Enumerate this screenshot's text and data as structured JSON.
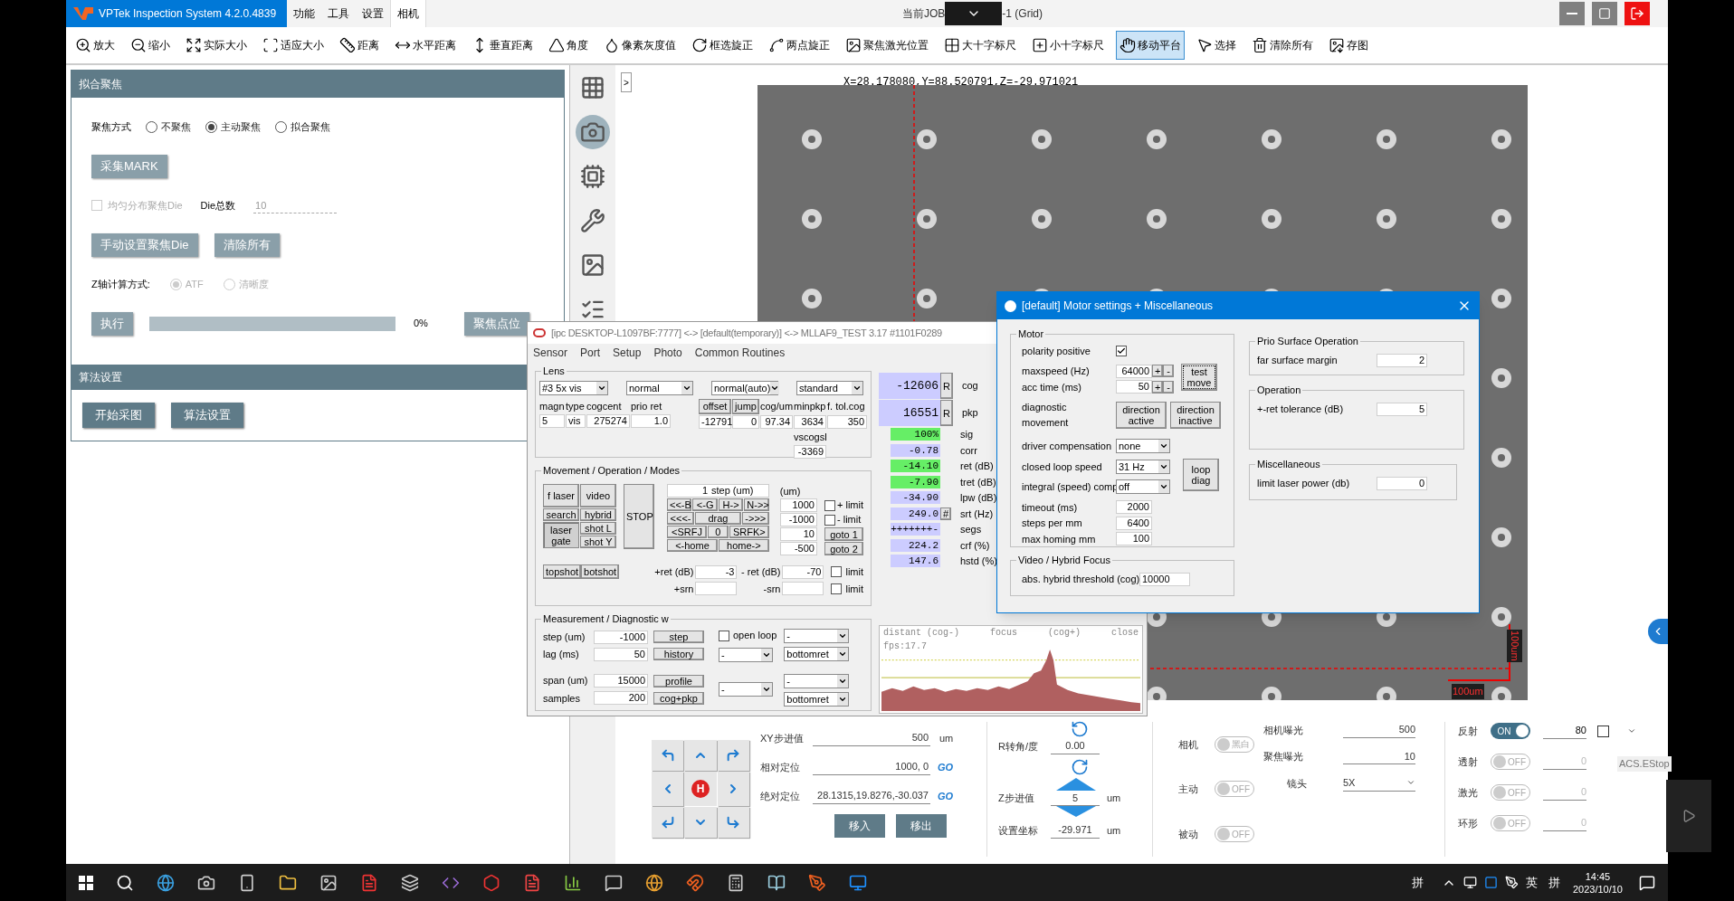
{
  "app_title": "VPTek Inspection System 4.2.0.4839",
  "menu": [
    {
      "label": "功能",
      "selected": false
    },
    {
      "label": "工具",
      "selected": false
    },
    {
      "label": "设置",
      "selected": false
    },
    {
      "label": "相机",
      "selected": true
    }
  ],
  "job": {
    "label": "当前JOB",
    "suffix": "-1 (Grid)"
  },
  "toolbar": [
    {
      "label": "放大",
      "selected": false
    },
    {
      "label": "缩小",
      "selected": false
    },
    {
      "label": "实际大小",
      "selected": false
    },
    {
      "label": "适应大小",
      "selected": false
    },
    {
      "label": "距离",
      "selected": false
    },
    {
      "label": "水平距离",
      "selected": false
    },
    {
      "label": "垂直距离",
      "selected": false
    },
    {
      "label": "角度",
      "selected": false
    },
    {
      "label": "像素灰度值",
      "selected": false
    },
    {
      "label": "框选旋正",
      "selected": false
    },
    {
      "label": "两点旋正",
      "selected": false
    },
    {
      "label": "聚焦激光位置",
      "selected": false
    },
    {
      "label": "大十字标尺",
      "selected": false
    },
    {
      "label": "小十字标尺",
      "selected": false
    },
    {
      "label": "移动平台",
      "selected": true
    },
    {
      "label": "选择",
      "selected": false
    },
    {
      "label": "清除所有",
      "selected": false
    },
    {
      "label": "存图",
      "selected": false
    }
  ],
  "focus_panel": {
    "title": "拟合聚焦",
    "mode_label": "聚焦方式",
    "modes": [
      {
        "label": "不聚焦",
        "selected": false
      },
      {
        "label": "主动聚焦",
        "selected": true
      },
      {
        "label": "拟合聚焦",
        "selected": false
      }
    ],
    "mark_button": {
      "label": "采集MARK",
      "disabled": true
    },
    "uniform": {
      "label": "均匀分布聚焦Die",
      "checked": false,
      "disabled": true
    },
    "die_count": {
      "label": "Die总数",
      "value": "10"
    },
    "die_buttons": [
      {
        "label": "手动设置聚焦Die",
        "disabled": true
      },
      {
        "label": "清除所有",
        "disabled": true
      }
    ],
    "z_label": "Z轴计算方式:",
    "z_modes": [
      {
        "label": "ATF",
        "selected": true,
        "disabled": true
      },
      {
        "label": "清晰度",
        "selected": false,
        "disabled": true
      }
    ],
    "run_button": {
      "label": "执行",
      "disabled": true
    },
    "progress": {
      "level": 0,
      "reading": "0%"
    },
    "points_button": {
      "label": "聚焦点位",
      "disabled": true
    }
  },
  "algo_panel": {
    "title": "算法设置",
    "buttons": [
      "开始采图",
      "算法设置"
    ]
  },
  "side_icons": [
    {
      "selected": false
    },
    {
      "selected": true
    },
    {
      "selected": false
    },
    {
      "selected": false
    },
    {
      "selected": false
    },
    {
      "selected": false
    }
  ],
  "collapse_button": ">",
  "viewer": {
    "coords": "X=28.178080,Y=88.520791,Z=-29.971021",
    "scale_x": "100um",
    "scale_y": "100um"
  },
  "msg_window": {
    "title": "[ipc DESKTOP-L1097BF:7777] <-> [default(temporary)] <-> MLLAF9_TEST 3.17 #1101F0289",
    "menus": [
      "Sensor",
      "Port",
      "Setup",
      "Photo",
      "Common Routines"
    ],
    "lens": {
      "title": "Lens",
      "selects": [
        "#3 5x vis",
        "normal",
        "normal(auto)",
        "standard"
      ],
      "headers": [
        "magn",
        "type",
        "cogcent",
        "prio ret"
      ],
      "values": [
        "5",
        "vis",
        "275274",
        "1.0"
      ],
      "buttons": [
        "offset",
        "jump"
      ],
      "headers2": [
        "cog/um",
        "minpkp",
        "f. tol.cog"
      ],
      "values2": [
        "-12791",
        "0",
        "97.34",
        "3634",
        "350"
      ],
      "vscogsl_label": "vscogsl",
      "vscogsl": "-3369"
    },
    "readouts": [
      {
        "value": "-12606",
        "button": "R",
        "label": "cog",
        "color": "#ccccff",
        "big": true
      },
      {
        "value": "16551",
        "button": "R",
        "label": "pkp",
        "color": "#ccccff",
        "big": true
      },
      {
        "value": "100%",
        "label": "sig",
        "color": "#66ee66",
        "big": false
      },
      {
        "value": "-0.78",
        "label": "corr",
        "color": "#ccccff",
        "big": false
      },
      {
        "value": "-14.10",
        "label": "ret (dB)",
        "color": "#66ee66",
        "big": false
      },
      {
        "value": "-7.90",
        "label": "tret (dB)",
        "color": "#66ee66",
        "big": false
      },
      {
        "value": "-34.90",
        "label": "lpw (dB)",
        "color": "#ccccff",
        "big": false
      },
      {
        "value": "249.0",
        "button": "#",
        "label": "srt (Hz)",
        "color": "#ccccff",
        "big": false
      },
      {
        "value": "+++++++-",
        "label": "segs",
        "color": "#ccccff",
        "big": false
      },
      {
        "value": "224.2",
        "label": "crf (%)",
        "color": "#ccccff",
        "big": false
      },
      {
        "value": "147.6",
        "label": "hstd (%)",
        "color": "#ccccff",
        "big": false
      }
    ],
    "movement": {
      "title": "Movement / Operation / Modes",
      "modes": [
        {
          "label": "f laser",
          "selected": false
        },
        {
          "label": "video",
          "selected": false
        },
        {
          "label": "search",
          "selected": false
        },
        {
          "label": "hybrid",
          "selected": false
        },
        {
          "label": "laser gate",
          "selected": true
        },
        {
          "label": "shot L",
          "selected": false
        },
        {
          "label": "shot Y",
          "selected": false
        }
      ],
      "stop": "STOP",
      "step_value": "1",
      "step_label": "step (um)",
      "jog": [
        "<<-B",
        "<-G",
        "H->",
        "N->>",
        "<<<-",
        "drag",
        "->>>",
        "<SRFJ",
        "0",
        "SRFK>",
        "<-home",
        "home->"
      ],
      "um_label": "(um)",
      "positions": [
        "1000",
        "-1000",
        "10",
        "-500"
      ],
      "limits": [
        {
          "label": "+ limit",
          "checked": false
        },
        {
          "label": "- limit",
          "checked": false
        }
      ],
      "goto": [
        "goto 1",
        "goto 2"
      ],
      "shots": [
        "topshot",
        "botshot"
      ],
      "ret_rows": [
        {
          "label": "+ret (dB)",
          "value": "-3",
          "label2": "- ret (dB)",
          "value2": "-70",
          "limit": "limit",
          "checked": false
        },
        {
          "label": "+srn",
          "label2": "-srn",
          "limit": "limit",
          "checked": false
        }
      ]
    },
    "measurement": {
      "title": "Measurement / Diagnostic w",
      "rows": [
        {
          "label": "step (um)",
          "value": "-1000",
          "button": "step"
        },
        {
          "label": "lag (ms)",
          "value": "50",
          "button": "history"
        },
        {
          "label": "span (um)",
          "value": "15000",
          "button": "profile"
        },
        {
          "label": "samples",
          "value": "200",
          "button": "cog+pkp"
        }
      ],
      "open_loop": {
        "label": "open loop",
        "checked": false
      },
      "selects": [
        "-",
        "-",
        "bottomret",
        "-",
        "-",
        "bottomret"
      ]
    },
    "chart": {
      "labels": [
        "distant (cog-)",
        "focus",
        "(cog+)",
        "close"
      ],
      "fps": "fps:17.7"
    }
  },
  "motor_window": {
    "title": "[default] Motor settings + Miscellaneous",
    "motor": {
      "title": "Motor",
      "polarity": {
        "label": "polarity positive",
        "checked": true
      },
      "speeds": [
        {
          "label": "maxspeed (Hz)",
          "value": "64000"
        },
        {
          "label": "acc time (ms)",
          "value": "50"
        }
      ],
      "plus": "+",
      "minus": "-",
      "test_button": "test move",
      "diag_label": "diagnostic movement",
      "diag_buttons": [
        "direction active",
        "direction inactive"
      ],
      "selects": [
        {
          "label": "driver compensation",
          "value": "none"
        },
        {
          "label": "closed loop speed",
          "value": "31 Hz"
        },
        {
          "label": "integral (speed) comp",
          "value": "off"
        }
      ],
      "loop_button": "loop diag",
      "fields": [
        {
          "label": "timeout (ms)",
          "value": "2000"
        },
        {
          "label": "steps per mm",
          "value": "6400"
        },
        {
          "label": "max homing mm",
          "value": "100"
        }
      ]
    },
    "video": {
      "title": "Video / Hybrid Focus",
      "label": "abs. hybrid threshold (cog)",
      "value": "10000"
    },
    "groups": [
      {
        "title": "Prio Surface Operation",
        "label": "far surface margin",
        "value": "2"
      },
      {
        "title": "Operation",
        "label": "+-ret tolerance (dB)",
        "value": "5"
      },
      {
        "title": "Miscellaneous",
        "label": "limit laser power (db)",
        "value": "0"
      }
    ]
  },
  "stage": {
    "home": "H",
    "rows": [
      {
        "label": "XY步进值",
        "value": "500",
        "unit": "um"
      },
      {
        "label": "相对定位",
        "value": "1000, 0",
        "go": "GO"
      },
      {
        "label": "绝对定位",
        "value": "28.1315,19.8276,-30.037",
        "go": "GO"
      }
    ],
    "buttons": [
      "移入",
      "移出"
    ],
    "rotation": {
      "label": "R转角/度",
      "value": "0.00"
    },
    "z_step": {
      "label": "Z步进值",
      "value": "5",
      "unit": "um"
    },
    "z_set": {
      "label": "设置坐标",
      "value": "-29.971",
      "unit": "um"
    }
  },
  "camera_toggles": [
    {
      "label": "相机",
      "on": false,
      "text": "黑白"
    },
    {
      "label": "主动",
      "on": false,
      "text": "OFF"
    },
    {
      "label": "被动",
      "on": false,
      "text": "OFF"
    }
  ],
  "exposure": [
    {
      "label": "相机曝光",
      "value": "500"
    },
    {
      "label": "聚焦曝光",
      "value": "10"
    }
  ],
  "lens_select": {
    "label": "镜头",
    "value": "5X"
  },
  "lights": [
    {
      "label": "反射",
      "on": true,
      "text": "ON",
      "value": "80"
    },
    {
      "label": "透射",
      "on": false,
      "text": "OFF",
      "value": "0"
    },
    {
      "label": "激光",
      "on": false,
      "text": "OFF",
      "value": "0"
    },
    {
      "label": "环形",
      "on": false,
      "text": "OFF",
      "value": "0"
    }
  ],
  "estop": "ACS.EStop",
  "taskbar": {
    "ime": "拼",
    "lang": "英",
    "ime2": "拼",
    "time": "14:45",
    "date": "2023/10/10"
  }
}
